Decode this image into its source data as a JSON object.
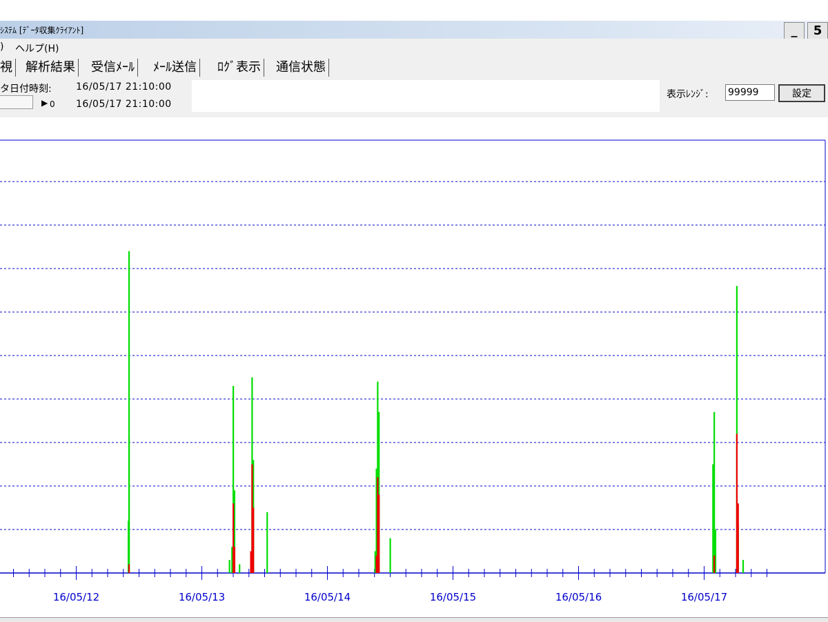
{
  "window": {
    "title": "ｼｽﾃﾑ [ﾃﾞｰﾀ収集ｸﾗｲｱﾝﾄ]",
    "minimize_glyph": "_",
    "restore_glyph": "5"
  },
  "menu": [
    {
      "label": ")"
    },
    {
      "label": "ヘルプ(H)"
    }
  ],
  "tabs": [
    {
      "label": "視",
      "active": true
    },
    {
      "label": "解析結果"
    },
    {
      "label": "受信ﾒｰﾙ"
    },
    {
      "label": "ﾒｰﾙ送信"
    },
    {
      "label": "ﾛｸﾞ表示"
    },
    {
      "label": "通信状態"
    }
  ],
  "info": {
    "datetime_label": "タ日付時刻:",
    "datetime_value": "16/05/17 21:10:00",
    "slider_value": "0",
    "slider_datetime": "16/05/17 21:10:00",
    "range_label": "表示ﾚﾝｼﾞ:",
    "range_value": "99999",
    "set_button": "設定"
  },
  "colors": {
    "axis": "#0000cc",
    "grid": "#0000cc",
    "series_green": "#00dd00",
    "series_red": "#ee0000"
  },
  "chart_data": {
    "type": "bar",
    "x_tick_labels": [
      "16/05/12",
      "16/05/13",
      "16/05/14",
      "16/05/15",
      "16/05/16",
      "16/05/17"
    ],
    "grid": true,
    "grid_style": "dotted",
    "x_range_days": [
      11.25,
      17.55
    ],
    "y_range": [
      0,
      10
    ],
    "series": [
      {
        "color": "green",
        "points": [
          {
            "x": 12.42,
            "y": 7.4
          },
          {
            "x": 12.415,
            "y": 1.2
          },
          {
            "x": 12.42,
            "y": 3.1
          },
          {
            "x": 13.25,
            "y": 4.3
          },
          {
            "x": 13.26,
            "y": 1.9
          },
          {
            "x": 13.24,
            "y": 0.6
          },
          {
            "x": 13.22,
            "y": 0.3
          },
          {
            "x": 13.4,
            "y": 4.5
          },
          {
            "x": 13.41,
            "y": 2.6
          },
          {
            "x": 13.39,
            "y": 0.4
          },
          {
            "x": 13.52,
            "y": 1.4
          },
          {
            "x": 13.3,
            "y": 0.2
          },
          {
            "x": 14.4,
            "y": 4.4
          },
          {
            "x": 14.41,
            "y": 3.7
          },
          {
            "x": 14.39,
            "y": 2.4
          },
          {
            "x": 14.38,
            "y": 0.5
          },
          {
            "x": 14.5,
            "y": 0.8
          },
          {
            "x": 17.08,
            "y": 3.7
          },
          {
            "x": 17.07,
            "y": 2.5
          },
          {
            "x": 17.09,
            "y": 1.0
          },
          {
            "x": 17.26,
            "y": 6.6
          },
          {
            "x": 17.27,
            "y": 1.1
          },
          {
            "x": 17.31,
            "y": 0.3
          }
        ]
      },
      {
        "color": "red",
        "points": [
          {
            "x": 12.42,
            "y": 0.2
          },
          {
            "x": 13.25,
            "y": 1.6
          },
          {
            "x": 13.26,
            "y": 0.6
          },
          {
            "x": 13.4,
            "y": 2.5
          },
          {
            "x": 13.41,
            "y": 1.5
          },
          {
            "x": 13.39,
            "y": 0.5
          },
          {
            "x": 14.4,
            "y": 2.2
          },
          {
            "x": 14.41,
            "y": 1.8
          },
          {
            "x": 14.39,
            "y": 0.4
          },
          {
            "x": 17.08,
            "y": 0.4
          },
          {
            "x": 17.26,
            "y": 3.2
          },
          {
            "x": 17.27,
            "y": 1.6
          }
        ]
      }
    ]
  }
}
